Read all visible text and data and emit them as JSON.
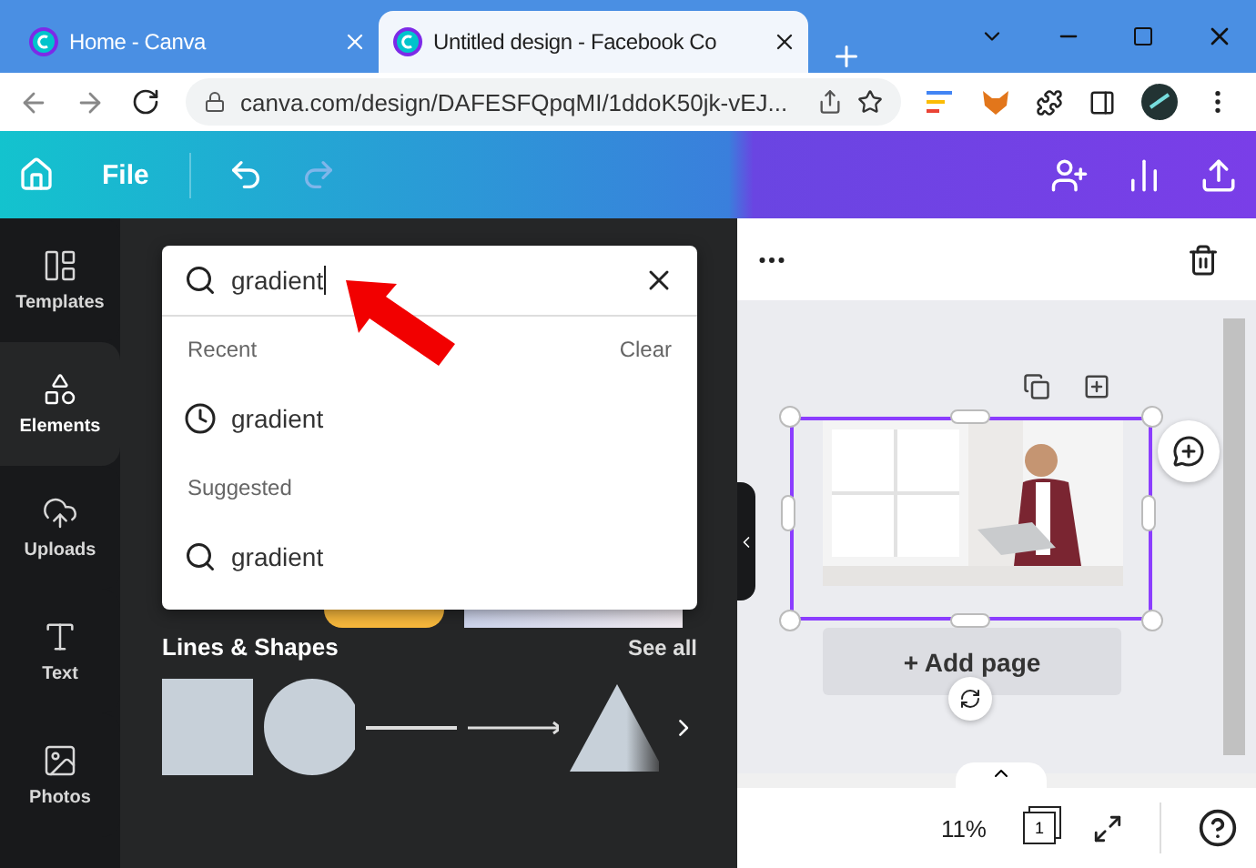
{
  "browser": {
    "tabs": [
      {
        "title": "Home - Canva",
        "selected": false
      },
      {
        "title": "Untitled design - Facebook Co",
        "selected": true
      }
    ],
    "url": "canva.com/design/DAFESFQpqMI/1ddoK50jk-vEJ..."
  },
  "toolbar": {
    "file": "File"
  },
  "sidebar": {
    "items": [
      {
        "label": "Templates",
        "selected": false
      },
      {
        "label": "Elements",
        "selected": true
      },
      {
        "label": "Uploads",
        "selected": false
      },
      {
        "label": "Text",
        "selected": false
      },
      {
        "label": "Photos",
        "selected": false
      }
    ]
  },
  "search": {
    "value": "gradient",
    "sections": [
      {
        "title": "Recent",
        "action": "Clear",
        "items": [
          {
            "kind": "recent",
            "text": "gradient"
          }
        ]
      },
      {
        "title": "Suggested",
        "items": [
          {
            "kind": "suggested",
            "text": "gradient"
          }
        ]
      }
    ]
  },
  "lines_shapes": {
    "title": "Lines & Shapes",
    "action": "See all"
  },
  "canvas": {
    "add_page": "+ Add page",
    "zoom": "11%",
    "page_count": "1"
  }
}
